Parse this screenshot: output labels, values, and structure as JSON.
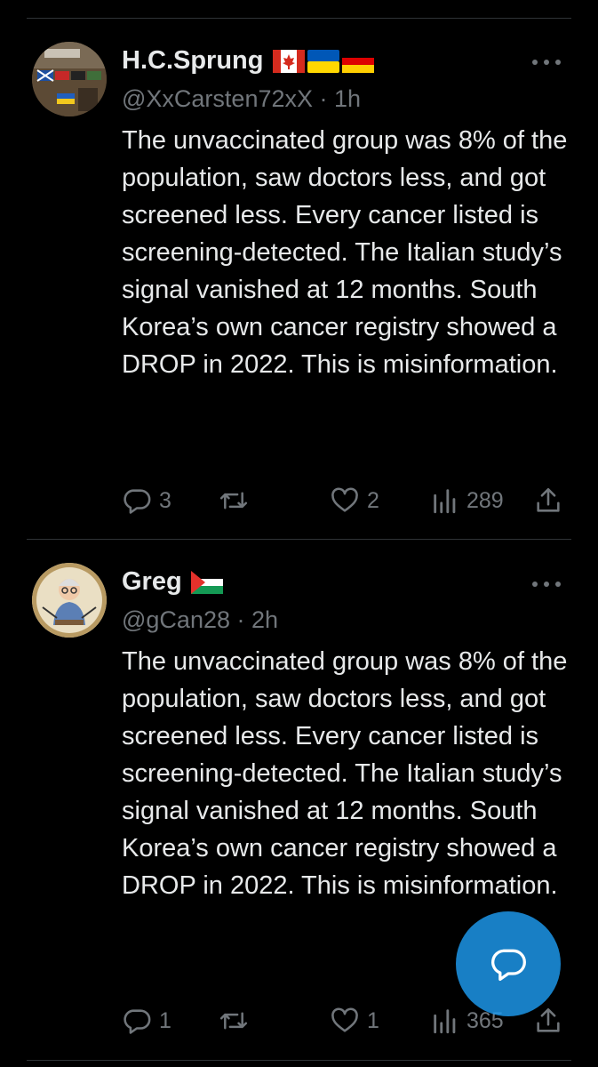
{
  "tweets": [
    {
      "display_name": "H.C.Sprung",
      "flags": [
        "canada-flag",
        "ukraine-flag",
        "germany-flag"
      ],
      "handle": "@XxCarsten72xX",
      "time": "1h",
      "text": "The unvaccinated group was 8% of the population, saw doctors less, and got screened less. Every cancer listed is screening-detected. The Italian study’s signal vanished at 12 months. South Korea’s own cancer registry showed a DROP in 2022. This is misinformation.",
      "replies": "3",
      "reposts": "",
      "likes": "2",
      "views": "289"
    },
    {
      "display_name": "Greg",
      "flags": [
        "palestine-flag"
      ],
      "handle": "@gCan28",
      "time": "2h",
      "text": "The unvaccinated group was 8% of the population, saw doctors less, and got screened less. Every cancer listed is screening-detected. The Italian study’s signal vanished at 12 months. South Korea’s own cancer registry showed a DROP in 2022. This is misinformation.",
      "replies": "1",
      "reposts": "",
      "likes": "1",
      "views": "365"
    }
  ],
  "separator": "·",
  "colors": {
    "background": "#000000",
    "text": "#e7e9ea",
    "muted": "#71767b",
    "accent": "#1d9bf0"
  }
}
